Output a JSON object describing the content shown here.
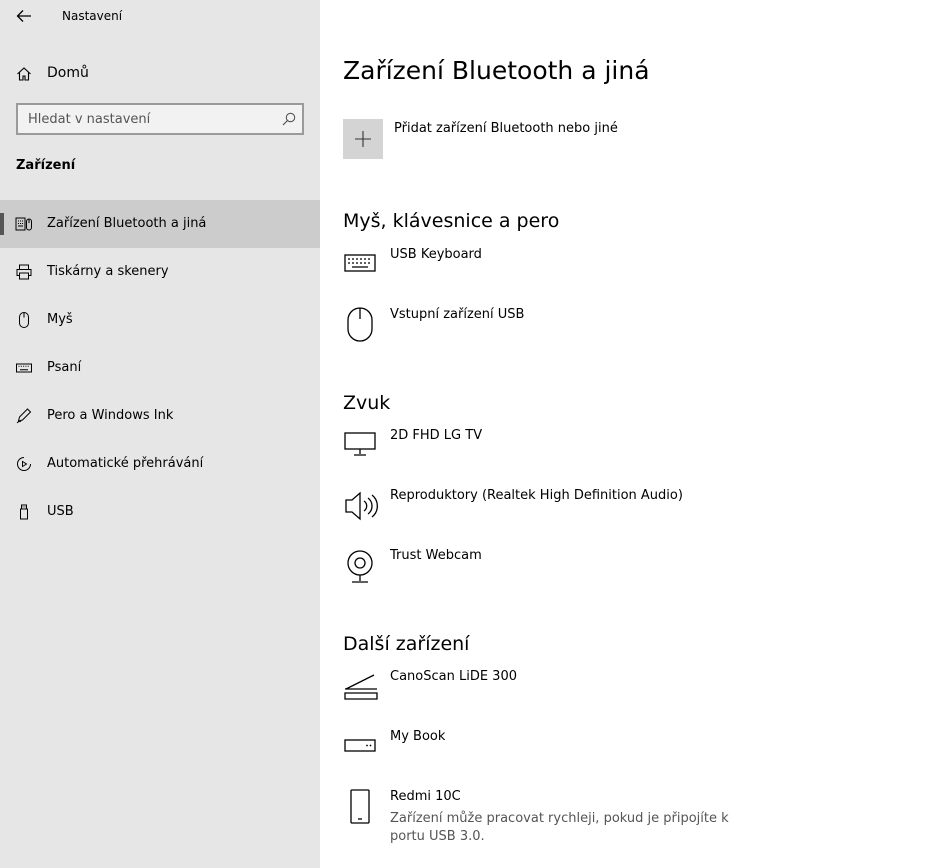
{
  "app": {
    "title": "Nastavení"
  },
  "sidebar": {
    "home_label": "Domů",
    "search_placeholder": "Hledat v nastavení",
    "group_label": "Zařízení",
    "items": [
      {
        "label": "Zařízení Bluetooth a jiná",
        "icon": "bluetooth-devices-icon",
        "active": true
      },
      {
        "label": "Tiskárny a skenery",
        "icon": "printer-icon"
      },
      {
        "label": "Myš",
        "icon": "mouse-icon"
      },
      {
        "label": "Psaní",
        "icon": "keyboard-icon"
      },
      {
        "label": "Pero a Windows Ink",
        "icon": "pen-icon"
      },
      {
        "label": "Automatické přehrávání",
        "icon": "autoplay-icon"
      },
      {
        "label": "USB",
        "icon": "usb-icon"
      }
    ]
  },
  "main": {
    "title": "Zařízení Bluetooth a jiná",
    "add_label": "Přidat zařízení Bluetooth nebo jiné",
    "sections": [
      {
        "heading": "Myš, klávesnice a pero",
        "devices": [
          {
            "name": "USB Keyboard",
            "icon": "keyboard-icon"
          },
          {
            "name": "Vstupní zařízení USB",
            "icon": "mouse-icon"
          }
        ]
      },
      {
        "heading": "Zvuk",
        "devices": [
          {
            "name": "2D FHD LG TV",
            "icon": "monitor-icon"
          },
          {
            "name": "Reproduktory (Realtek High Definition Audio)",
            "icon": "speaker-icon"
          },
          {
            "name": "Trust Webcam",
            "icon": "webcam-icon"
          }
        ]
      },
      {
        "heading": "Další zařízení",
        "devices": [
          {
            "name": "CanoScan LiDE 300",
            "icon": "scanner-icon"
          },
          {
            "name": "My Book",
            "icon": "external-drive-icon"
          },
          {
            "name": "Redmi 10C",
            "icon": "phone-icon",
            "status": "Zařízení může pracovat rychleji, pokud je připojíte k portu USB 3.0."
          }
        ]
      }
    ]
  }
}
